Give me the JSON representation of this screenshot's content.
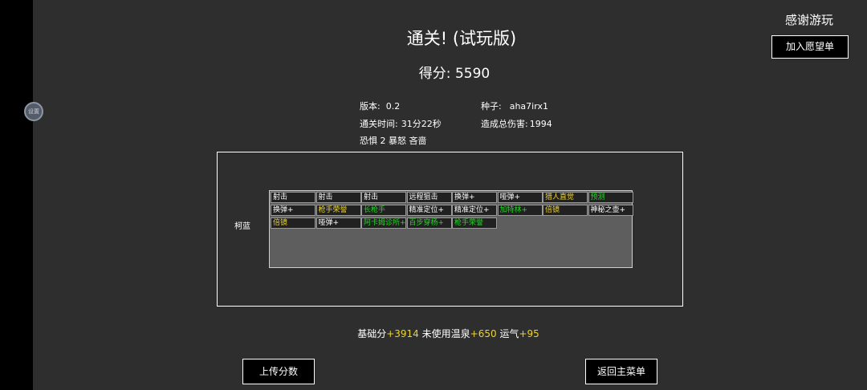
{
  "title": "通关! (试玩版)",
  "score": {
    "label": "得分:",
    "value": "5590"
  },
  "thanks": "感谢游玩",
  "buttons": {
    "wishlist": "加入愿望单",
    "upload": "上传分数",
    "main_menu": "返回主菜单"
  },
  "side_handle_text": "设置",
  "info": {
    "version": {
      "label": "版本:",
      "value": "0.2"
    },
    "seed": {
      "label": "种子:",
      "value": "aha7irx1"
    },
    "time": {
      "label": "通关时间:",
      "value": "31分22秒"
    },
    "damage": {
      "label": "造成总伤害:",
      "value": "1994"
    },
    "traits": "恐惧 2 暴怒 吝啬"
  },
  "character": "柯蓝",
  "items": [
    {
      "name": "射击",
      "color": "#ffffff"
    },
    {
      "name": "射击",
      "color": "#ffffff"
    },
    {
      "name": "射击",
      "color": "#ffffff"
    },
    {
      "name": "远程狙击",
      "color": "#ffffff"
    },
    {
      "name": "换弹+",
      "color": "#ffffff"
    },
    {
      "name": "哑弹+",
      "color": "#ffffff"
    },
    {
      "name": "猎人直觉",
      "color": "#ecd331"
    },
    {
      "name": "预测",
      "color": "#24d624"
    },
    {
      "name": "换弹+",
      "color": "#ffffff"
    },
    {
      "name": "枪手荣誉",
      "color": "#ecd331"
    },
    {
      "name": "长枪手",
      "color": "#24d624"
    },
    {
      "name": "精准定位+",
      "color": "#ffffff"
    },
    {
      "name": "精准定位+",
      "color": "#ffffff"
    },
    {
      "name": "加特林+",
      "color": "#24d624"
    },
    {
      "name": "倍镜",
      "color": "#ecd331"
    },
    {
      "name": "神秘之壶+",
      "color": "#ffffff"
    },
    {
      "name": "倍镜",
      "color": "#ecd331"
    },
    {
      "name": "哑弹+",
      "color": "#ffffff"
    },
    {
      "name": "阿卡姆诊所+",
      "color": "#24d624"
    },
    {
      "name": "百步穿杨+",
      "color": "#24d624"
    },
    {
      "name": "枪手荣誉",
      "color": "#24d624"
    }
  ],
  "summary": {
    "base_label": "基础分",
    "base_value": "+3914",
    "spring_label": "未使用温泉",
    "spring_value": "+650",
    "luck_label": "运气",
    "luck_value": "+95"
  }
}
